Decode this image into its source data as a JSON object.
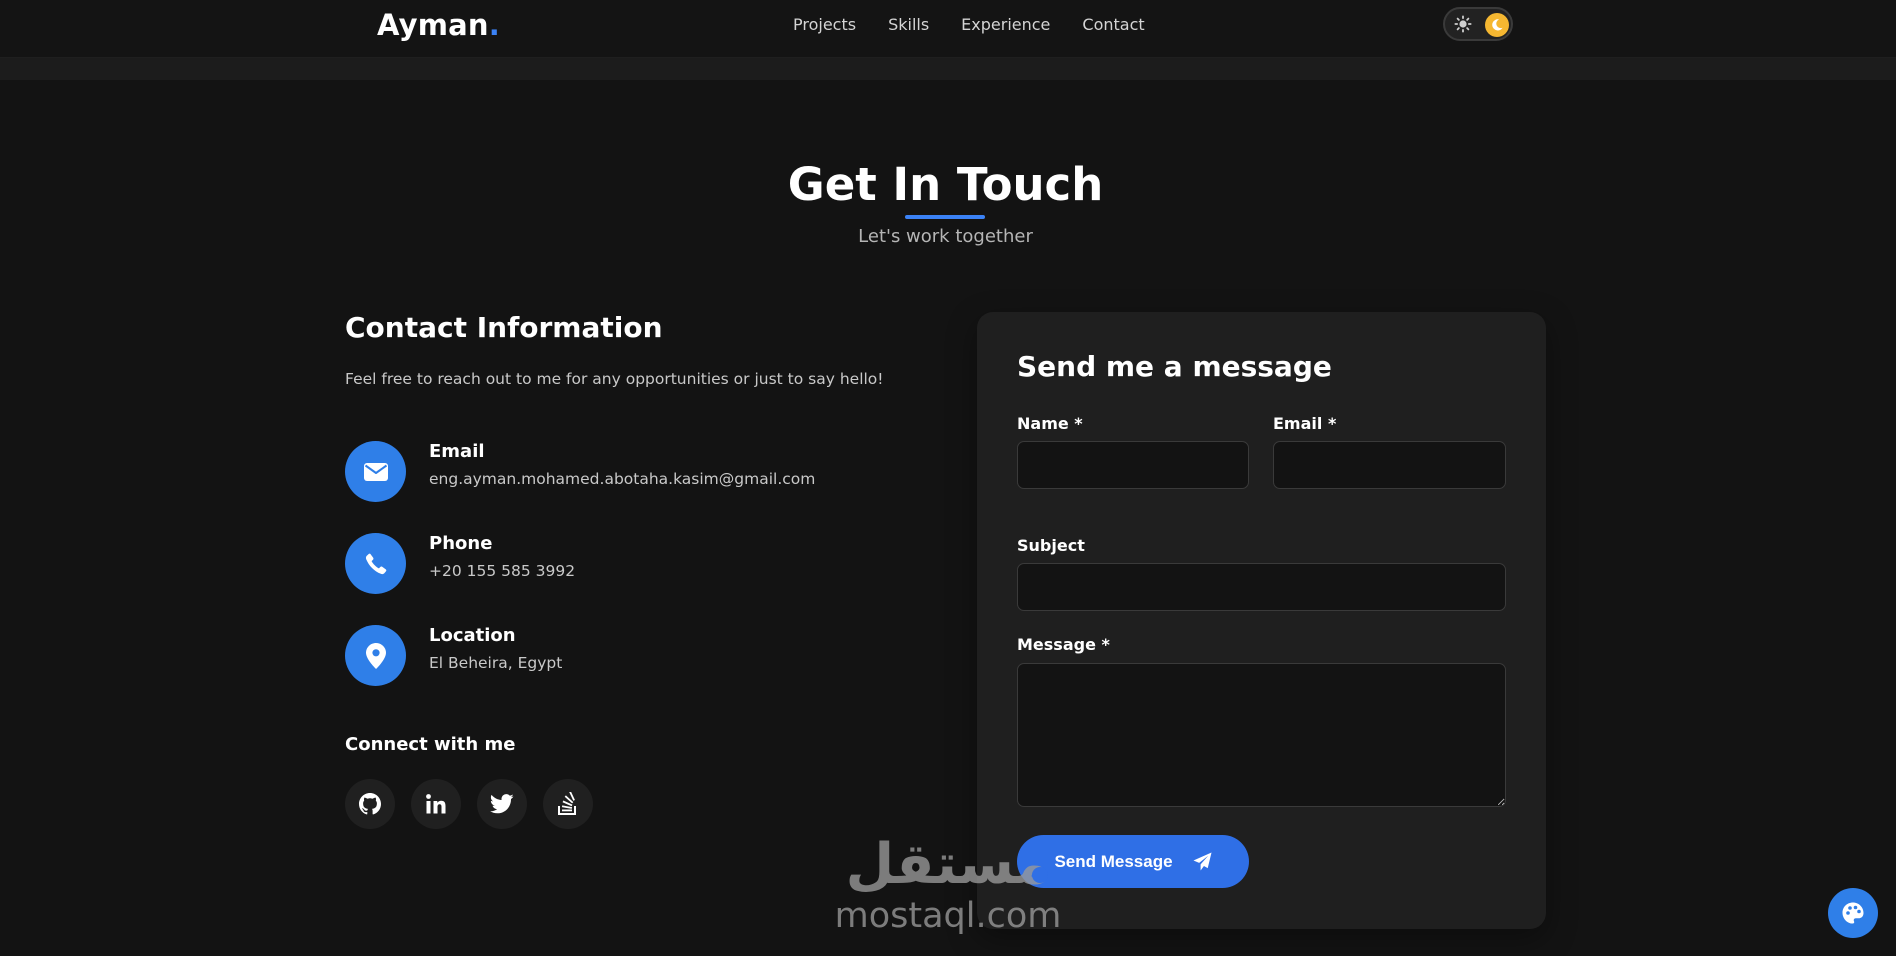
{
  "nav": {
    "logo_text": "Ayman",
    "logo_dot": ".",
    "links": [
      "Projects",
      "Skills",
      "Experience",
      "Contact"
    ],
    "theme_toggle_state": "dark"
  },
  "section": {
    "title": "Get In Touch",
    "subtitle": "Let's work together"
  },
  "contact": {
    "heading": "Contact Information",
    "description": "Feel free to reach out to me for any opportunities or just to say hello!",
    "items": [
      {
        "label": "Email",
        "value": "eng.ayman.mohamed.abotaha.kasim@gmail.com",
        "icon": "envelope-icon"
      },
      {
        "label": "Phone",
        "value": "+20 155 585 3992",
        "icon": "phone-icon"
      },
      {
        "label": "Location",
        "value": "El Beheira, Egypt",
        "icon": "map-pin-icon"
      }
    ],
    "connect_heading": "Connect with me",
    "socials": [
      "github-icon",
      "linkedin-icon",
      "twitter-icon",
      "stackoverflow-icon"
    ]
  },
  "form": {
    "title": "Send me a message",
    "name_label": "Name *",
    "name_value": "",
    "email_label": "Email *",
    "email_value": "",
    "subject_label": "Subject",
    "subject_value": "",
    "message_label": "Message *",
    "message_value": "",
    "submit_label": "Send Message"
  },
  "watermark": {
    "arabic": "مستقل",
    "latin": "mostaql.com"
  },
  "colors": {
    "background": "#131313",
    "card": "#1f1f1f",
    "accent": "#3b82f6",
    "button": "#2f6fe6",
    "toggle_knob": "#f5b731"
  }
}
